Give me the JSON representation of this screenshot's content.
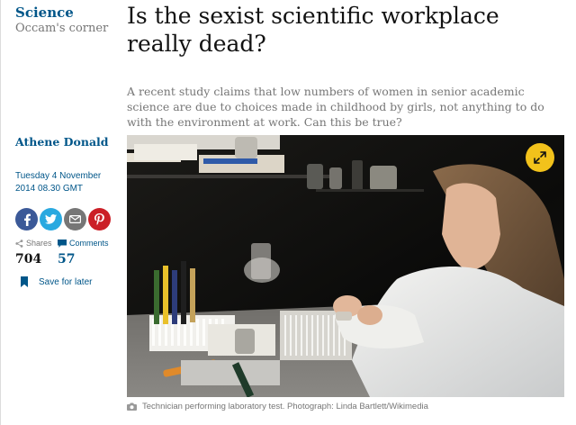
{
  "section": {
    "title": "Science",
    "series": "Occam's corner"
  },
  "article": {
    "headline": "Is the sexist scientific workplace really dead?",
    "standfirst": "A recent study claims that low numbers of women in senior academic science are due to choices made in childhood by girls, not anything to do with the environment at work. Can this be true?",
    "byline": "Athene Donald",
    "date_line1": "Tuesday 4 November",
    "date_line2": "2014 08.30 GMT"
  },
  "share": {
    "buttons": [
      {
        "icon": "facebook-icon",
        "color": "#3b5998"
      },
      {
        "icon": "twitter-icon",
        "color": "#2aa9e0"
      },
      {
        "icon": "email-icon",
        "color": "#767676"
      },
      {
        "icon": "pinterest-icon",
        "color": "#cb1f27"
      }
    ]
  },
  "stats": {
    "shares_label": "Shares",
    "shares_value": "704",
    "comments_label": "Comments",
    "comments_value": "57"
  },
  "save_label": "Save for later",
  "image": {
    "caption": "Technician performing laboratory test. Photograph: Linda Bartlett/Wikimedia"
  },
  "colors": {
    "accent": "#005689",
    "expand_button": "#f2c21b",
    "muted": "#767676"
  }
}
